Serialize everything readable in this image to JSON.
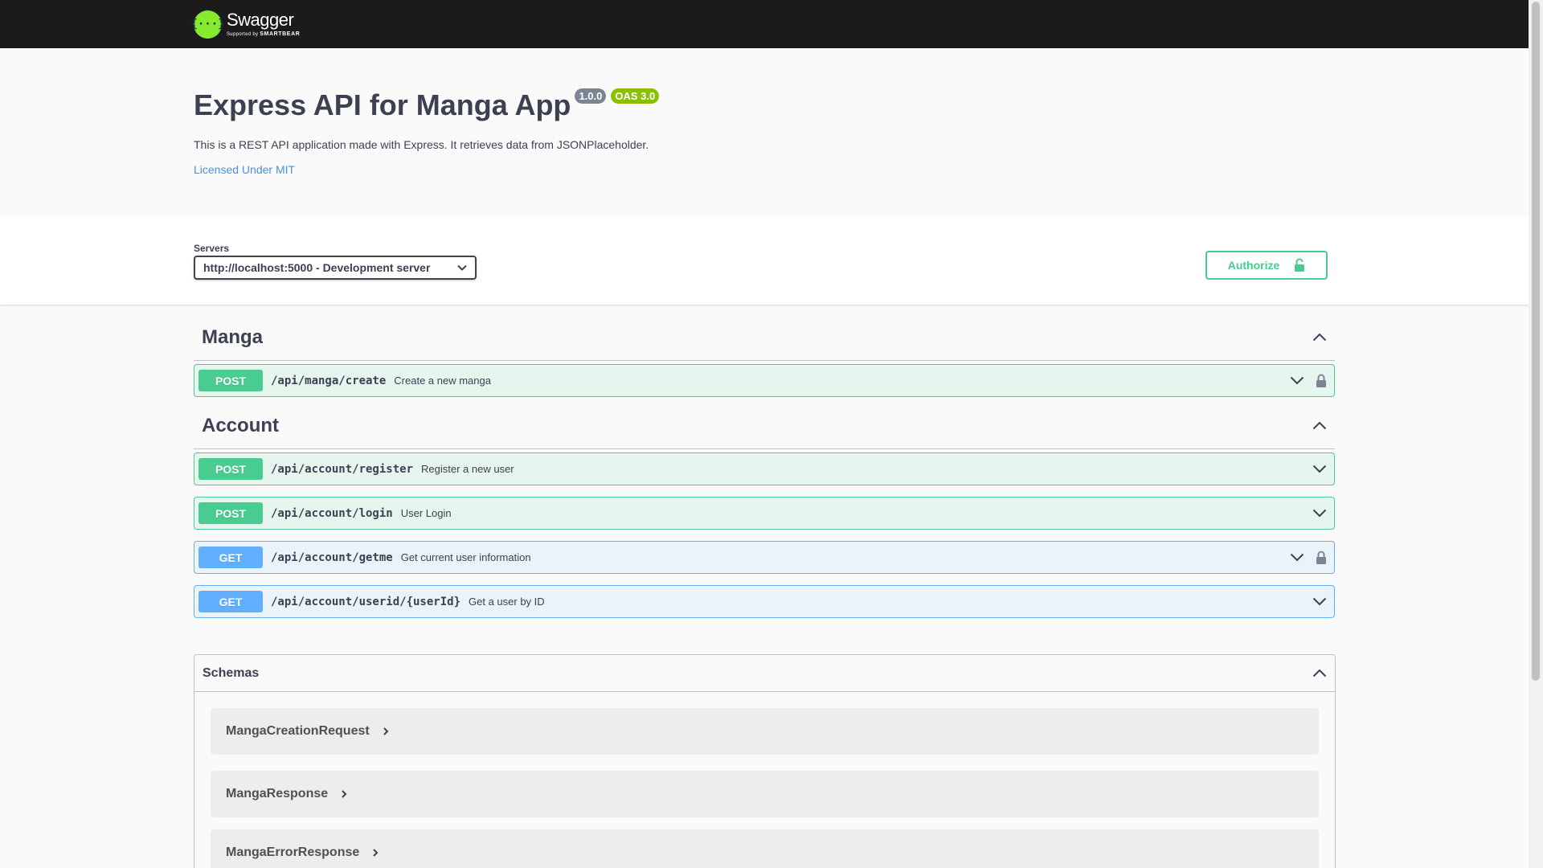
{
  "topbar": {
    "logo_glyph": "{···}",
    "logo_name": "Swagger",
    "logo_sub_prefix": "Supported by",
    "logo_sub_brand": "SMARTBEAR"
  },
  "info": {
    "title": "Express API for Manga App",
    "version": "1.0.0",
    "oas": "OAS 3.0",
    "description": "This is a REST API application made with Express. It retrieves data from JSONPlaceholder.",
    "license": "Licensed Under MIT"
  },
  "servers": {
    "label": "Servers",
    "selected": "http://localhost:5000 - Development server"
  },
  "authorize_label": "Authorize",
  "tags": [
    {
      "name": "Manga",
      "operations": [
        {
          "method": "POST",
          "path": "/api/manga/create",
          "summary": "Create a new manga",
          "locked": true
        }
      ]
    },
    {
      "name": "Account",
      "operations": [
        {
          "method": "POST",
          "path": "/api/account/register",
          "summary": "Register a new user",
          "locked": false
        },
        {
          "method": "POST",
          "path": "/api/account/login",
          "summary": "User Login",
          "locked": false
        },
        {
          "method": "GET",
          "path": "/api/account/getme",
          "summary": "Get current user information",
          "locked": true
        },
        {
          "method": "GET",
          "path": "/api/account/userid/{userId}",
          "summary": "Get a user by ID",
          "locked": false
        }
      ]
    }
  ],
  "schemas": {
    "title": "Schemas",
    "models": [
      "MangaCreationRequest",
      "MangaResponse",
      "MangaErrorResponse"
    ]
  },
  "colors": {
    "post": "#49cc90",
    "get": "#61affe",
    "topbar": "#1b1b1b",
    "logo": "#85ea2d",
    "version_badge": "#7d8492",
    "oas_badge": "#89bf04",
    "link": "#4990e2"
  },
  "icons": {
    "chevron_up": "chevron-up-icon",
    "chevron_down": "chevron-down-icon",
    "chevron_right": "chevron-right-icon",
    "lock": "lock-icon",
    "unlock": "unlock-icon"
  }
}
